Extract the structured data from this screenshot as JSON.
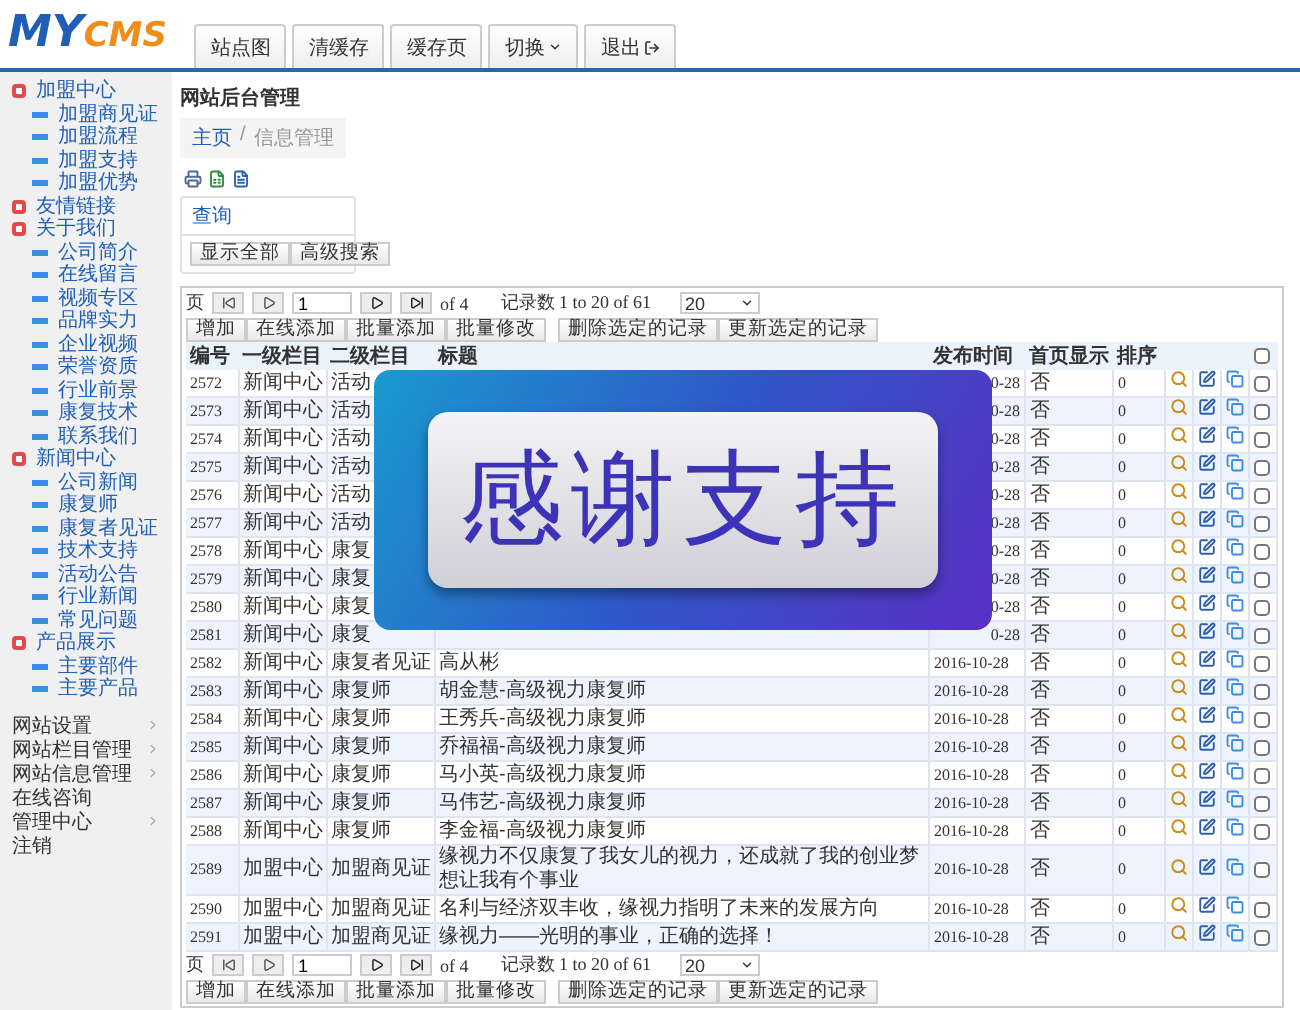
{
  "logo": {
    "part_1": "MY",
    "part_2": "CMS"
  },
  "top_tabs": [
    {
      "label": "站点图",
      "kind": "plain"
    },
    {
      "label": "清缓存",
      "kind": "plain"
    },
    {
      "label": "缓存页",
      "kind": "plain"
    },
    {
      "label": "切换",
      "kind": "menu"
    },
    {
      "label": "退出",
      "kind": "logout"
    }
  ],
  "sidebar": {
    "groups": [
      {
        "label": "加盟中心",
        "children": [
          "加盟商见证",
          "加盟流程",
          "加盟支持",
          "加盟优势"
        ]
      },
      {
        "label": "友情链接"
      },
      {
        "label": "关于我们",
        "children": [
          "公司简介",
          "在线留言",
          "视频专区",
          "品牌实力",
          "企业视频",
          "荣誉资质",
          "行业前景",
          "康复技术",
          "联系我们"
        ]
      },
      {
        "label": "新闻中心",
        "children": [
          "公司新闻",
          "康复师",
          "康复者见证",
          "技术支持",
          "活动公告",
          "行业新闻",
          "常见问题"
        ]
      },
      {
        "label": "产品展示",
        "children": [
          "主要部件",
          "主要产品"
        ]
      }
    ],
    "menu": [
      {
        "label": "网站设置",
        "has_submenu": true
      },
      {
        "label": "网站栏目管理",
        "has_submenu": true
      },
      {
        "label": "网站信息管理",
        "has_submenu": true
      },
      {
        "label": "在线咨询",
        "has_submenu": false
      },
      {
        "label": "管理中心",
        "has_submenu": true
      },
      {
        "label": "注销",
        "has_submenu": false
      }
    ]
  },
  "page_title": "网站后台管理",
  "breadcrumb": {
    "items": [
      "主页",
      "信息管理"
    ],
    "separator": "/"
  },
  "query_panel": {
    "title": "查询",
    "buttons": [
      "显示全部",
      "高级搜索"
    ]
  },
  "pager_top": {
    "label": "页",
    "page": "1",
    "of": "of 4",
    "records": "记录数 1 to 20 of 61",
    "page_size": "20"
  },
  "actions_top": {
    "group_1": [
      "增加",
      "在线添加",
      "批量添加",
      "批量修改"
    ],
    "group_2": [
      "删除选定的记录",
      "更新选定的记录"
    ]
  },
  "table": {
    "columns": [
      "编号",
      "一级栏目",
      "二级栏目",
      "标题",
      "发布时间",
      "首页显示",
      "排序"
    ],
    "select_all_checked": false,
    "rows": [
      {
        "id": "2572",
        "column_1": "新闻中心",
        "column_2": "活动",
        "date": "0-28",
        "home": "否",
        "order": "0",
        "checked": false
      },
      {
        "id": "2573",
        "column_1": "新闻中心",
        "column_2": "活动",
        "date": "0-28",
        "home": "否",
        "order": "0",
        "checked": false
      },
      {
        "id": "2574",
        "column_1": "新闻中心",
        "column_2": "活动",
        "date": "0-28",
        "home": "否",
        "order": "0",
        "checked": false
      },
      {
        "id": "2575",
        "column_1": "新闻中心",
        "column_2": "活动",
        "date": "0-28",
        "home": "否",
        "order": "0",
        "checked": false
      },
      {
        "id": "2576",
        "column_1": "新闻中心",
        "column_2": "活动",
        "date": "0-28",
        "home": "否",
        "order": "0",
        "checked": false
      },
      {
        "id": "2577",
        "column_1": "新闻中心",
        "column_2": "活动",
        "date": "0-28",
        "home": "否",
        "order": "0",
        "checked": false
      },
      {
        "id": "2578",
        "column_1": "新闻中心",
        "column_2": "康复",
        "date": "0-28",
        "home": "否",
        "order": "0",
        "checked": false
      },
      {
        "id": "2579",
        "column_1": "新闻中心",
        "column_2": "康复",
        "date": "0-28",
        "home": "否",
        "order": "0",
        "checked": false
      },
      {
        "id": "2580",
        "column_1": "新闻中心",
        "column_2": "康复",
        "date": "0-28",
        "home": "否",
        "order": "0",
        "checked": false
      },
      {
        "id": "2581",
        "column_1": "新闻中心",
        "column_2": "康复",
        "date": "0-28",
        "home": "否",
        "order": "0",
        "checked": false
      },
      {
        "id": "2582",
        "column_1": "新闻中心",
        "column_2": "康复者见证",
        "title": "高从彬",
        "date": "2016-10-28",
        "home": "否",
        "order": "0",
        "checked": false
      },
      {
        "id": "2583",
        "column_1": "新闻中心",
        "column_2": "康复师",
        "title": "胡金慧-高级视力康复师",
        "date": "2016-10-28",
        "home": "否",
        "order": "0",
        "checked": false
      },
      {
        "id": "2584",
        "column_1": "新闻中心",
        "column_2": "康复师",
        "title": "王秀兵-高级视力康复师",
        "date": "2016-10-28",
        "home": "否",
        "order": "0",
        "checked": false
      },
      {
        "id": "2585",
        "column_1": "新闻中心",
        "column_2": "康复师",
        "title": "乔福福-高级视力康复师",
        "date": "2016-10-28",
        "home": "否",
        "order": "0",
        "checked": false
      },
      {
        "id": "2586",
        "column_1": "新闻中心",
        "column_2": "康复师",
        "title": "马小英-高级视力康复师",
        "date": "2016-10-28",
        "home": "否",
        "order": "0",
        "checked": false
      },
      {
        "id": "2587",
        "column_1": "新闻中心",
        "column_2": "康复师",
        "title": "马伟艺-高级视力康复师",
        "date": "2016-10-28",
        "home": "否",
        "order": "0",
        "checked": false
      },
      {
        "id": "2588",
        "column_1": "新闻中心",
        "column_2": "康复师",
        "title": "李金福-高级视力康复师",
        "date": "2016-10-28",
        "home": "否",
        "order": "0",
        "checked": false
      },
      {
        "id": "2589",
        "column_1": "加盟中心",
        "column_2": "加盟商见证",
        "title": "缘视力不仅康复了我女儿的视力，还成就了我的创业梦想让我有个事业",
        "date": "2016-10-28",
        "home": "否",
        "order": "0",
        "checked": false
      },
      {
        "id": "2590",
        "column_1": "加盟中心",
        "column_2": "加盟商见证",
        "title": "名利与经济双丰收，缘视力指明了未来的发展方向",
        "date": "2016-10-28",
        "home": "否",
        "order": "0",
        "checked": false
      },
      {
        "id": "2591",
        "column_1": "加盟中心",
        "column_2": "加盟商见证",
        "title": "缘视力——光明的事业，正确的选择！",
        "date": "2016-10-28",
        "home": "否",
        "order": "0",
        "checked": false
      }
    ]
  },
  "pager_bottom": {
    "label": "页",
    "page": "1",
    "of": "of 4",
    "records": "记录数 1 to 20 of 61",
    "page_size": "20"
  },
  "actions_bottom": {
    "group_1": [
      "增加",
      "在线添加",
      "批量添加",
      "批量修改"
    ],
    "group_2": [
      "删除选定的记录",
      "更新选定的记录"
    ]
  },
  "banner": {
    "text": "感谢支持"
  }
}
